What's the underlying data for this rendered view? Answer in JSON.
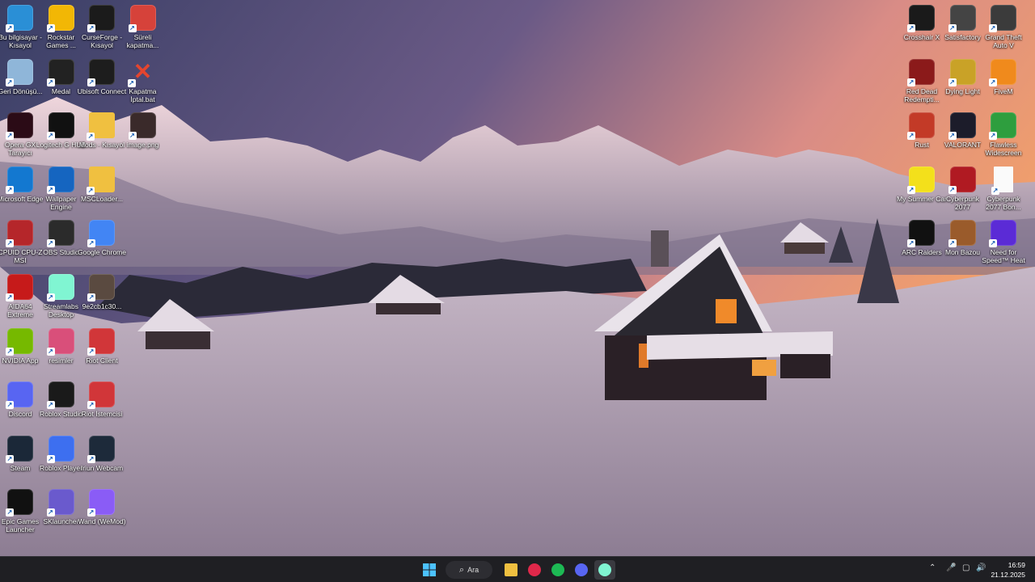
{
  "desktop": {
    "icons_left": [
      {
        "id": "this-pc",
        "label": "Bu bilgisayar - Kısayol",
        "icon": "monitor-icon",
        "color": "#2a8fd6"
      },
      {
        "id": "rockstar",
        "label": "Rockstar Games ...",
        "icon": "rockstar-icon",
        "color": "#f2b705"
      },
      {
        "id": "curseforge",
        "label": "CurseForge - Kısayol",
        "icon": "curseforge-icon",
        "color": "#1b1b1b"
      },
      {
        "id": "sureli",
        "label": "Süreli kapatma...",
        "icon": "power-icon",
        "color": "#d6423a"
      },
      {
        "id": "recycle",
        "label": "Geri Dönüşü...",
        "icon": "recycle-bin-icon",
        "color": "#8fb6d9"
      },
      {
        "id": "medal",
        "label": "Medal",
        "icon": "medal-icon",
        "color": "#222"
      },
      {
        "id": "ubisoft",
        "label": "Ubisoft Connect",
        "icon": "ubisoft-icon",
        "color": "#1d1d1d"
      },
      {
        "id": "kapatma",
        "label": "Kapatma İptal.bat",
        "icon": "x-icon",
        "color": "transparent"
      },
      {
        "id": "operagx",
        "label": "Opera GX Tarayıcı",
        "icon": "opera-gx-icon",
        "color": "#2b0b16"
      },
      {
        "id": "logitech",
        "label": "Logitech G HUB",
        "icon": "logitech-icon",
        "color": "#111"
      },
      {
        "id": "mods",
        "label": "Mods - Kısayol",
        "icon": "folder-icon",
        "color": "#f0c040"
      },
      {
        "id": "image",
        "label": "image.png",
        "icon": "image-thumb-icon",
        "color": "#3a2a2a"
      },
      {
        "id": "edge",
        "label": "Microsoft Edge",
        "icon": "edge-icon",
        "color": "#1378d0"
      },
      {
        "id": "wallpaper",
        "label": "Wallpaper Engine",
        "icon": "wallpaper-engine-icon",
        "color": "#1565c0"
      },
      {
        "id": "mscloader",
        "label": "MSCLoader...",
        "icon": "folder-icon",
        "color": "#f0c040"
      },
      {
        "id": "cpuid",
        "label": "CPUID CPU-Z MSI",
        "icon": "cpuz-icon",
        "color": "#b5262a"
      },
      {
        "id": "obs",
        "label": "OBS Studio",
        "icon": "obs-icon",
        "color": "#2b2b2b"
      },
      {
        "id": "chrome",
        "label": "Google Chrome",
        "icon": "chrome-icon",
        "color": "#4285f4"
      },
      {
        "id": "aida",
        "label": "AIDA64 Extreme",
        "icon": "aida64-icon",
        "color": "#c61a1a"
      },
      {
        "id": "streamlabs",
        "label": "Streamlabs Desktop",
        "icon": "streamlabs-icon",
        "color": "#80f5d2"
      },
      {
        "id": "9e2cb",
        "label": "9e2cb1c30...",
        "icon": "image-thumb-icon",
        "color": "#5a4a40"
      },
      {
        "id": "nvidia",
        "label": "NVIDIA App",
        "icon": "nvidia-icon",
        "color": "#76b900"
      },
      {
        "id": "resimler",
        "label": "resimler",
        "icon": "cube-icon",
        "color": "#d94f7a"
      },
      {
        "id": "riot",
        "label": "Riot Client",
        "icon": "riot-icon",
        "color": "#d13639"
      },
      {
        "id": "discord",
        "label": "Discord",
        "icon": "discord-icon",
        "color": "#5865f2"
      },
      {
        "id": "roblox-studio",
        "label": "Roblox Studio",
        "icon": "roblox-studio-icon",
        "color": "#1a1a1a"
      },
      {
        "id": "riot2",
        "label": "Riot İstemcisi",
        "icon": "riot-icon",
        "color": "#d13639"
      },
      {
        "id": "steam",
        "label": "Steam",
        "icon": "steam-icon",
        "color": "#1b2838"
      },
      {
        "id": "roblox-player",
        "label": "Roblox Player",
        "icon": "roblox-icon",
        "color": "#3d6ff0"
      },
      {
        "id": "iriun",
        "label": "Iriun Webcam",
        "icon": "webcam-icon",
        "color": "#1d2a3a"
      },
      {
        "id": "epic",
        "label": "Epic Games Launcher",
        "icon": "epic-icon",
        "color": "#111"
      },
      {
        "id": "sklauncher",
        "label": "SKlauncher",
        "icon": "sklauncher-icon",
        "color": "#6a5acd"
      },
      {
        "id": "wand",
        "label": "Wand (WeMod)",
        "icon": "wand-icon",
        "color": "#8a5cf6"
      }
    ],
    "icons_right": [
      {
        "id": "crosshair",
        "label": "Crosshair X",
        "icon": "crosshair-icon",
        "color": "#1a1a1a"
      },
      {
        "id": "satisfactory",
        "label": "Satisfactory",
        "icon": "satisfactory-icon",
        "color": "#444"
      },
      {
        "id": "gta",
        "label": "Grand Theft Auto V",
        "icon": "gta-icon",
        "color": "#3b3b3b"
      },
      {
        "id": "rdr",
        "label": "Red Dead Redempti...",
        "icon": "rdr-icon",
        "color": "#8b1a1a"
      },
      {
        "id": "dyinglight",
        "label": "Dying Light",
        "icon": "dying-light-icon",
        "color": "#c9a227"
      },
      {
        "id": "fivem",
        "label": "FiveM",
        "icon": "fivem-icon",
        "color": "#f08a1c"
      },
      {
        "id": "rust",
        "label": "Rust",
        "icon": "rust-icon",
        "color": "#c33a27"
      },
      {
        "id": "valorant",
        "label": "VALORANT",
        "icon": "valorant-icon",
        "color": "#1c1c2a"
      },
      {
        "id": "flawless",
        "label": "Flawless Widescreen",
        "icon": "flawless-icon",
        "color": "#2e9e3e"
      },
      {
        "id": "msc",
        "label": "My Summer Car",
        "icon": "msc-icon",
        "color": "#f3e01b"
      },
      {
        "id": "cyberpunk",
        "label": "Cyberpunk 2077",
        "icon": "cyberpunk-icon",
        "color": "#b01a22"
      },
      {
        "id": "cyberpunk-bonus",
        "label": "Cyberpunk 2077 Bon...",
        "icon": "document-icon",
        "color": "#fafafa"
      },
      {
        "id": "arc",
        "label": "ARC Raiders",
        "icon": "arc-raiders-icon",
        "color": "#111"
      },
      {
        "id": "mon-bazou",
        "label": "Mon Bazou",
        "icon": "mon-bazou-icon",
        "color": "#9a5b2b"
      },
      {
        "id": "nfs",
        "label": "Need for Speed™ Heat",
        "icon": "nfs-icon",
        "color": "#5b2bd6"
      }
    ]
  },
  "taskbar": {
    "search_label": "Ara",
    "apps": [
      {
        "id": "file-explorer",
        "icon": "folder-icon",
        "color": "#f0c040"
      },
      {
        "id": "opera",
        "icon": "opera-gx-icon",
        "color": "#e0284a"
      },
      {
        "id": "spotify",
        "icon": "spotify-icon",
        "color": "#1db954"
      },
      {
        "id": "discord",
        "icon": "discord-icon",
        "color": "#5865f2"
      },
      {
        "id": "streamlabs",
        "icon": "streamlabs-icon",
        "color": "#80f5d2"
      }
    ],
    "time": "16:59",
    "date": "21.12.2025"
  }
}
